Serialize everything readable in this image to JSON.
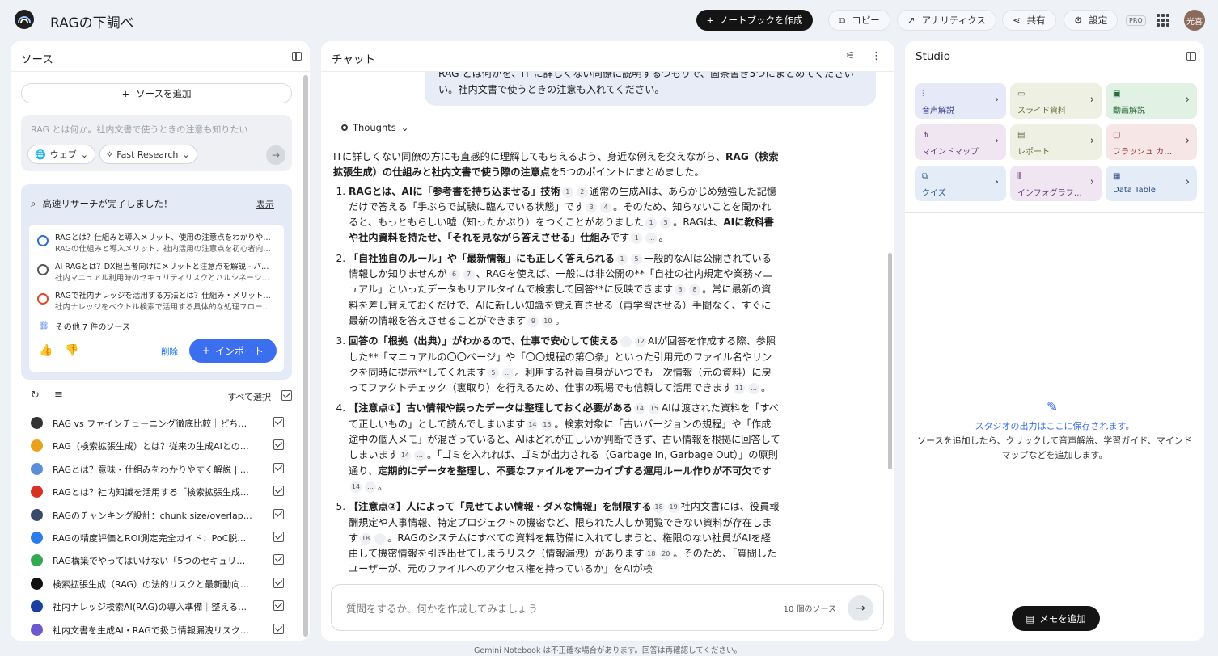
{
  "header": {
    "title": "RAGの下調べ",
    "create_notebook": "ノートブックを作成",
    "copy": "コピー",
    "analytics": "アナリティクス",
    "share": "共有",
    "settings": "設定",
    "pro_badge": "PRO",
    "avatar_initials": "光喜"
  },
  "source_panel": {
    "title": "ソース",
    "add_source": "ソースを追加",
    "research_placeholder": "RAG とは何か。社内文書で使うときの注意も知りたい",
    "chip_web": "ウェブ",
    "chip_research": "Fast Research",
    "result_heading": "高速リサーチが完了しました！",
    "result_show": "表示",
    "results": [
      {
        "title": "RAGとは？仕組みと導入メリット、使用の注意点をわかりや…",
        "subtitle": "RAGの仕組みと導入メリット、社内活用の注意点を初心者向…",
        "color": "#2f6bd9"
      },
      {
        "title": "AI RAGとは？DX担当者向けにメリットと注意点を解説 - パー…",
        "subtitle": "社内マニュアル利用時のセキュリティリスクとハルシネーシ…",
        "color": "#555555"
      },
      {
        "title": "RAGで社内ナレッジを活用する方法とは？仕組み・メリット…",
        "subtitle": "社内ナレッジをベクトル検索で活用する具体的な処理フロー…",
        "color": "#d94a2f"
      }
    ],
    "more_sources": "その他 7 件のソース",
    "delete": "削除",
    "import": "インポート",
    "select_all": "すべて選択",
    "sources": [
      {
        "label": "RAG vs ファインチューニング徹底比較｜どち…",
        "color": "#333333"
      },
      {
        "label": "RAG（検索拡張生成）とは？従来の生成AIとの…",
        "color": "#e8a21e"
      },
      {
        "label": "RAGとは？意味・仕組みをわかりやすく解説 | …",
        "color": "#5b8fd6"
      },
      {
        "label": "RAGとは？社内知識を活用する「検索拡張生成…",
        "color": "#d93025"
      },
      {
        "label": "RAGのチャンキング設計：chunk size/overlapと…",
        "color": "#3a4a6b"
      },
      {
        "label": "RAGの精度評価とROI測定完全ガイド：PoC脱…",
        "color": "#2b7de9"
      },
      {
        "label": "RAG構築でやってはいけない「5つのセキュリ…",
        "color": "#34a853"
      },
      {
        "label": "検索拡張生成（RAG）の法的リスクと最新動向…",
        "color": "#111111"
      },
      {
        "label": "社内ナレッジ検索AI(RAG)の導入準備｜整える…",
        "color": "#1a3fa0"
      },
      {
        "label": "社内文書を生成AI・RAGで扱う情報漏洩リスク…",
        "color": "#6a5acd"
      }
    ]
  },
  "chat": {
    "title": "チャット",
    "user_message_line1": "RAG とは何かを、IT に詳しくない同僚に説明するつもりで、箇条書き5つにまとめてください",
    "user_message_line2": "い。社内文書で使うときの注意も入れてください。",
    "thoughts": "Thoughts",
    "intro_a": "ITに詳しくない同僚の方にも直感的に理解してもらえるよう、身近な例えを交えながら、",
    "intro_bold": "RAG（検索拡張生成）の仕組みと社内文書で使う際の注意点",
    "intro_b": "を5つのポイントにまとめました。",
    "p1_bold": "RAGとは、AIに「参考書を持ち込ませる」技術",
    "p1_c1": "1",
    "p1_c2": "2",
    "p1_text_a": "通常の生成AIは、あらかじめ勉強した記憶だけで答える「手ぶらで試験に臨んでいる状態」です",
    "p1_c3": "3",
    "p1_c4": "4",
    "p1_text_b": "。そのため、知らないことを聞かれると、もっともらしい嘘（知ったかぶり）をつくことがありました",
    "p1_c5": "1",
    "p1_c6": "5",
    "p1_text_c": "。RAGは、",
    "p1_bold2": "AIに教科書や社内資料を持たせ、「それを見ながら答えさせる」仕組み",
    "p1_text_d": "です",
    "p1_c7": "1",
    "p1_c8": "…",
    "p1_end": "。",
    "p2_bold": "「自社独自のルール」や「最新情報」にも正しく答えられる",
    "p2_c1": "1",
    "p2_c2": "5",
    "p2_text_a": "一般的なAIは公開されている情報しか知りませんが",
    "p2_c3": "6",
    "p2_c4": "7",
    "p2_text_b": "、RAGを使えば、一般には非公開の**「自社の社内規定や業務マニュアル」といったデータもリアルタイムで検索して回答**に反映できます",
    "p2_c5": "3",
    "p2_c6": "8",
    "p2_text_c": "。常に最新の資料を差し替えておくだけで、AIに新しい知識を覚え直させる（再学習させる）手間なく、すぐに最新の情報を答えさせることができます",
    "p2_c7": "9",
    "p2_c8": "10",
    "p2_end": "。",
    "p3_bold": "回答の「根拠（出典）」がわかるので、仕事で安心して使える",
    "p3_c1": "11",
    "p3_c2": "12",
    "p3_text_a": "AIが回答を作成する際、参照した**「マニュアルの〇〇ページ」や「〇〇規程の第〇条」といった引用元のファイル名やリンクを同時に提示**してくれます",
    "p3_c3": "5",
    "p3_c4": "…",
    "p3_text_b": "。利用する社員自身がいつでも一次情報（元の資料）に戻ってファクトチェック（裏取り）を行えるため、仕事の現場でも信頼して活用できます",
    "p3_c5": "11",
    "p3_c6": "…",
    "p3_end": "。",
    "p4_bold": "【注意点①】古い情報や誤ったデータは整理しておく必要がある",
    "p4_c1": "14",
    "p4_c2": "15",
    "p4_text_a": "AIは渡された資料を「すべて正しいもの」として読んでしまいます",
    "p4_c3": "14",
    "p4_c4": "15",
    "p4_text_b": "。検索対象に「古いバージョンの規程」や「作成途中の個人メモ」が混ざっていると、AIはどれが正しいか判断できず、古い情報を根拠に回答してしまいます",
    "p4_c5": "14",
    "p4_c6": "…",
    "p4_text_c": "。「ゴミを入れれば、ゴミが出力される（Garbage In, Garbage Out）」の原則通り、",
    "p4_bold2": "定期的にデータを整理し、不要なファイルをアーカイブする運用ルール作りが不可欠",
    "p4_text_d": "です",
    "p4_c7": "14",
    "p4_c8": "…",
    "p4_end": "。",
    "p5_bold": "【注意点②】人によって「見せてよい情報・ダメな情報」を制限する",
    "p5_c1": "18",
    "p5_c2": "19",
    "p5_text_a": "社内文書には、役員報酬規定や人事情報、特定プロジェクトの機密など、限られた人しか閲覧できない資料が存在します",
    "p5_c3": "18",
    "p5_c4": "…",
    "p5_text_b": "。RAGのシステムにすべての資料を無防備に入れてしまうと、権限のない社員がAIを経由して機密情報を引き出せてしまうリスク（情報漏洩）があります",
    "p5_c5": "18",
    "p5_c6": "20",
    "p5_text_c": "。そのため、「質問したユーザーが、元のファイルへのアクセス権を持っているか」をAIが検",
    "input_placeholder": "質問をするか、何かを作成してみましょう",
    "source_count": "10 個のソース",
    "disclaimer": "Gemini Notebook は不正確な場合があります。回答は再確認してください。"
  },
  "studio": {
    "title": "Studio",
    "tiles": [
      {
        "label": "音声解説",
        "bg": "#e6e9f7",
        "fg": "#3a3f8a"
      },
      {
        "label": "スライド資料",
        "bg": "#eef0e4",
        "fg": "#6b6a3f"
      },
      {
        "label": "動画解説",
        "bg": "#e1f1e4",
        "fg": "#2e6b3c"
      },
      {
        "label": "マインドマップ",
        "bg": "#efe6f2",
        "fg": "#6b3a78"
      },
      {
        "label": "レポート",
        "bg": "#eef0e4",
        "fg": "#6b6a3f"
      },
      {
        "label": "フラッシュ カ…",
        "bg": "#f6e6e6",
        "fg": "#8a3a3a"
      },
      {
        "label": "クイズ",
        "bg": "#e4ecf7",
        "fg": "#2f5a8a"
      },
      {
        "label": "インフォグラフ…",
        "bg": "#efe6f2",
        "fg": "#6b3a78"
      },
      {
        "label": "Data Table",
        "bg": "#e4ecf7",
        "fg": "#2f4a7a"
      }
    ],
    "empty_title": "スタジオの出力はここに保存されます。",
    "empty_desc": "ソースを追加したら、クリックして音声解説、学習ガイド、マインドマップなどを追加します。",
    "add_memo": "メモを追加"
  }
}
